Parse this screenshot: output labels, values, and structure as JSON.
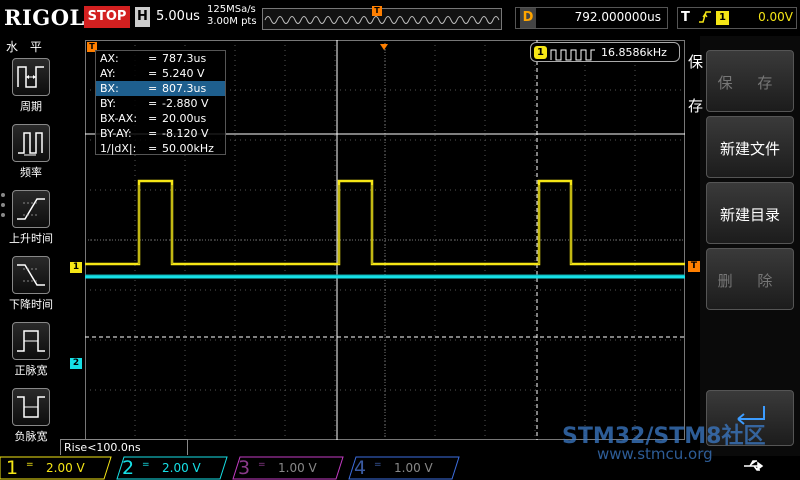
{
  "header": {
    "brand": "RIGOL",
    "run_state": "STOP",
    "h_label": "H",
    "timebase": "5.00us",
    "sample_rate": "125MSa/s",
    "memory_depth": "3.00M pts",
    "trigger_pos_label": "T",
    "delay_label": "D",
    "delay_value": "792.000000us",
    "trigger_label": "T",
    "trigger_source": "1",
    "trigger_level": "0.00V"
  },
  "left_menu": {
    "title": "水 平",
    "items": [
      {
        "label": "周期",
        "icon": "period-icon"
      },
      {
        "label": "频率",
        "icon": "frequency-icon"
      },
      {
        "label": "上升时间",
        "icon": "rise-time-icon"
      },
      {
        "label": "下降时间",
        "icon": "fall-time-icon"
      },
      {
        "label": "正脉宽",
        "icon": "positive-width-icon"
      },
      {
        "label": "负脉宽",
        "icon": "negative-width-icon"
      }
    ]
  },
  "cursor_readout": {
    "rows": [
      {
        "key": "AX:",
        "value": "787.3us"
      },
      {
        "key": "AY:",
        "value": "5.240 V"
      },
      {
        "key": "BX:",
        "value": "807.3us",
        "selected": true
      },
      {
        "key": "BY:",
        "value": "-2.880 V"
      },
      {
        "key": "BX-AX:",
        "value": "20.00us"
      },
      {
        "key": "BY-AY:",
        "value": "-8.120 V"
      },
      {
        "key": "1/|dX|:",
        "value": "50.00kHz"
      }
    ]
  },
  "frequency_measurement": {
    "channel": "1",
    "value": "16.8586kHz"
  },
  "markers": {
    "ch1": "1",
    "ch2": "2",
    "trigger_level": "T",
    "trigger_position": "T"
  },
  "status": {
    "rise": "Rise<100.0ns"
  },
  "right_menu": {
    "title": "保存",
    "keys": [
      {
        "label": "保 存",
        "enabled": false
      },
      {
        "label": "新建文件",
        "enabled": true
      },
      {
        "label": "新建目录",
        "enabled": true
      },
      {
        "label": "删 除",
        "enabled": false
      }
    ]
  },
  "channels": [
    {
      "num": "1",
      "coupling": "=",
      "scale": "2.00 V",
      "color": "#f5e616",
      "active": true
    },
    {
      "num": "2",
      "coupling": "=",
      "scale": "2.00 V",
      "color": "#16e0e6",
      "active": true
    },
    {
      "num": "3",
      "coupling": "=",
      "scale": "1.00 V",
      "color": "#c43cc4",
      "active": false
    },
    {
      "num": "4",
      "coupling": "=",
      "scale": "1.00 V",
      "color": "#3c6ee0",
      "active": false
    }
  ],
  "watermark": {
    "line1": "STM32/STM8社区",
    "line2": "www.stmcu.org"
  },
  "colors": {
    "ch1": "#f5e616",
    "ch2": "#16e0e6",
    "trigger": "#ff7f00",
    "stop": "#d32020"
  }
}
